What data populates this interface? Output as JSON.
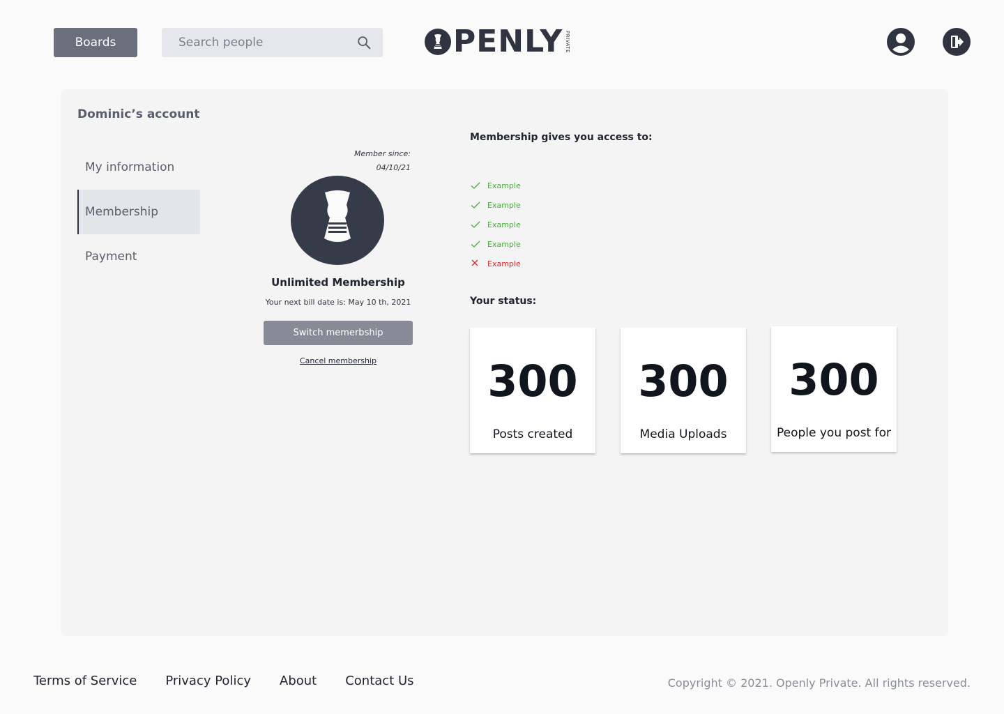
{
  "header": {
    "boards_label": "Boards",
    "search_placeholder": "Search people",
    "logo_text": "PENLY",
    "logo_subtext": "PRIVATE"
  },
  "account": {
    "title": "Dominic’s account",
    "nav": [
      {
        "label": "My information",
        "active": false
      },
      {
        "label": "Membership",
        "active": true
      },
      {
        "label": "Payment",
        "active": false
      }
    ]
  },
  "membership": {
    "member_since_label": "Member since:",
    "member_since_date": "04/10/21",
    "plan_name": "Unlimited Membership",
    "next_bill": "Your next bill date is: May 10 th, 2021",
    "switch_label": "Switch memerbship",
    "cancel_label": "Cancel membership"
  },
  "access": {
    "title": "Membership gives you access to:",
    "items": [
      {
        "label": "Example",
        "included": true
      },
      {
        "label": "Example",
        "included": true
      },
      {
        "label": "Example",
        "included": true
      },
      {
        "label": "Example",
        "included": true
      },
      {
        "label": "Example",
        "included": false
      }
    ]
  },
  "status": {
    "title": "Your status:",
    "cards": [
      {
        "value": "300",
        "label": "Posts created"
      },
      {
        "value": "300",
        "label": "Media Uploads"
      },
      {
        "value": "300",
        "label": "People you post for"
      }
    ]
  },
  "footer": {
    "links": [
      "Terms of Service",
      "Privacy Policy",
      "About",
      "Contact Us"
    ],
    "copyright": "Copyright © 2021. Openly Private. All rights reserved."
  },
  "colors": {
    "primary_dark": "#2f3440",
    "button_gray": "#6b6f7c",
    "included_green": "#4caa3e",
    "excluded_red": "#d8262b"
  }
}
